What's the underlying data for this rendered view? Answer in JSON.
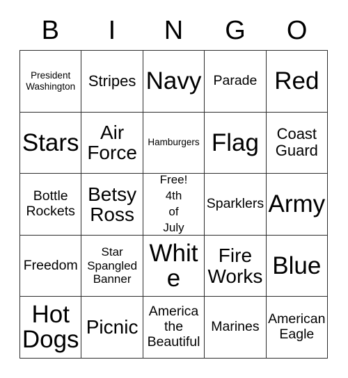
{
  "card": {
    "title_letters": [
      "B",
      "I",
      "N",
      "G",
      "O"
    ],
    "grid": {
      "columns": 5,
      "rows": 5,
      "border_color": "#2b2b2b",
      "background_color": "#ffffff",
      "text_color": "#000000"
    },
    "cells": [
      [
        {
          "text": "President\nWashington",
          "size": "xs"
        },
        {
          "text": "Stripes",
          "size": "lg"
        },
        {
          "text": "Navy",
          "size": "xxl"
        },
        {
          "text": "Parade",
          "size": "md"
        },
        {
          "text": "Red",
          "size": "xxl"
        }
      ],
      [
        {
          "text": "Stars",
          "size": "xxl"
        },
        {
          "text": "Air\nForce",
          "size": "xl"
        },
        {
          "text": "Hamburgers",
          "size": "xs"
        },
        {
          "text": "Flag",
          "size": "xxl"
        },
        {
          "text": "Coast\nGuard",
          "size": "lg"
        }
      ],
      [
        {
          "text": "Bottle\nRockets",
          "size": "md"
        },
        {
          "text": "Betsy\nRoss",
          "size": "xl"
        },
        {
          "text": "Free!\n4th\nof\nJuly",
          "size": "free",
          "free_space": true
        },
        {
          "text": "Sparklers",
          "size": "md"
        },
        {
          "text": "Army",
          "size": "xxl"
        }
      ],
      [
        {
          "text": "Freedom",
          "size": "md"
        },
        {
          "text": "Star\nSpangled\nBanner",
          "size": "sm"
        },
        {
          "text": "White",
          "size": "xxl"
        },
        {
          "text": "Fire\nWorks",
          "size": "xl"
        },
        {
          "text": "Blue",
          "size": "xxl"
        }
      ],
      [
        {
          "text": "Hot\nDogs",
          "size": "xxl"
        },
        {
          "text": "Picnic",
          "size": "xl"
        },
        {
          "text": "America\nthe\nBeautiful",
          "size": "md"
        },
        {
          "text": "Marines",
          "size": "md"
        },
        {
          "text": "American\nEagle",
          "size": "md"
        }
      ]
    ]
  }
}
